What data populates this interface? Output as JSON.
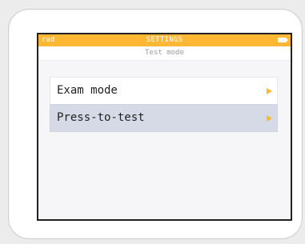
{
  "status_bar": {
    "left_label": "rad",
    "title": "SETTINGS",
    "battery_icon": "battery-icon",
    "background_color": "#ffb734"
  },
  "subheader": {
    "title": "Test mode"
  },
  "menu": {
    "items": [
      {
        "label": "Exam mode",
        "selected": false,
        "icon": "chevron-right-icon"
      },
      {
        "label": "Press-to-test",
        "selected": true,
        "icon": "chevron-right-icon"
      }
    ],
    "arrow_color": "#ffb734",
    "selected_color": "#d6d9e6"
  }
}
